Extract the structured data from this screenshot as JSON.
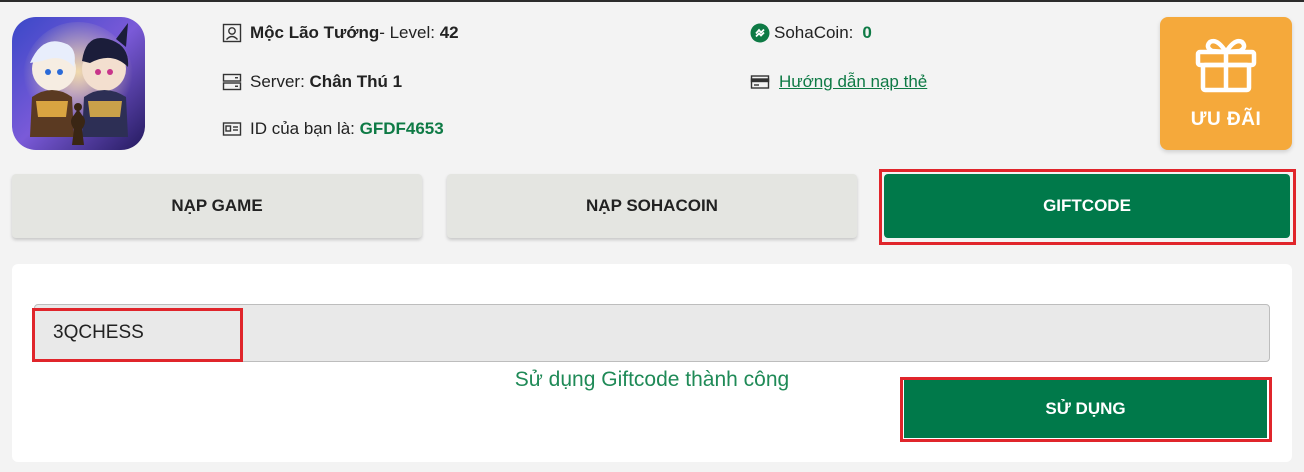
{
  "user": {
    "name": "Mộc Lão Tướng",
    "level_prefix": "- Level: ",
    "level": "42",
    "server_label": "Server: ",
    "server": "Chân Thú 1",
    "id_label": "ID của bạn là: ",
    "id": "GFDF4653"
  },
  "coin": {
    "label": "SohaCoin:",
    "value": "0",
    "guide_link": "Hướng dẫn nạp thẻ"
  },
  "promo": {
    "label": "ƯU ĐÃI"
  },
  "tabs": [
    {
      "label": "NẠP GAME"
    },
    {
      "label": "NẠP SOHACOIN"
    },
    {
      "label": "GIFTCODE"
    }
  ],
  "giftcode": {
    "value": "3QCHESS",
    "success_message": "Sử dụng Giftcode thành công",
    "submit_label": "SỬ DỤNG"
  },
  "colors": {
    "accent_green": "#00794a",
    "promo_orange": "#f5a93b",
    "highlight_red": "#e0252b"
  }
}
